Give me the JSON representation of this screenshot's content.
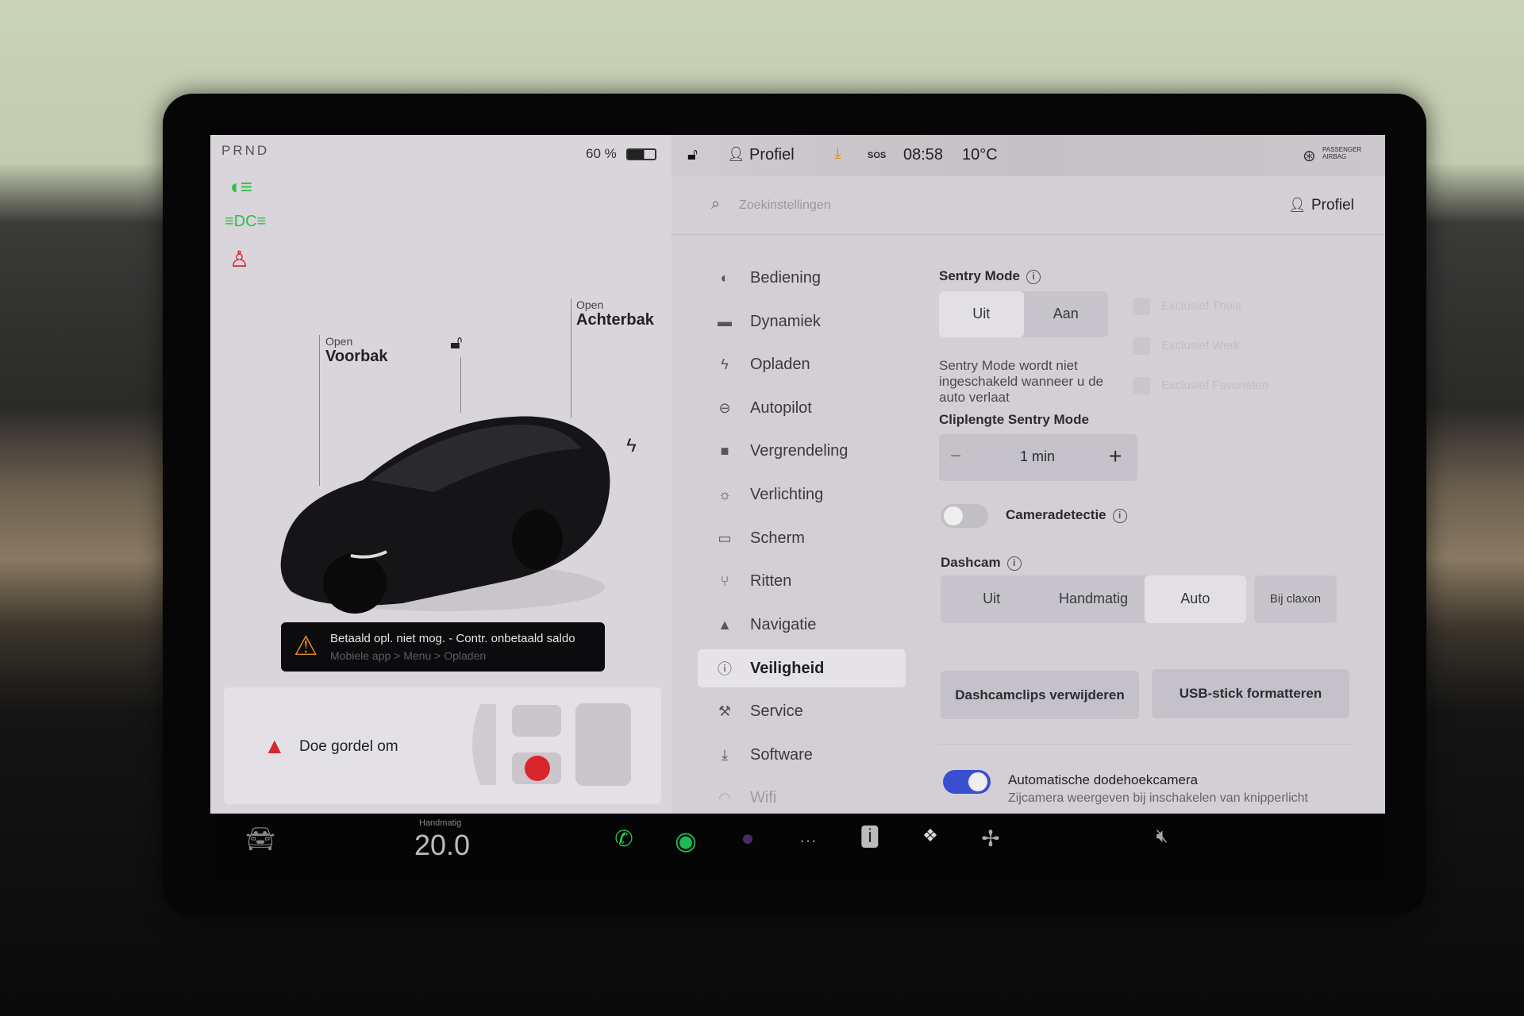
{
  "status": {
    "gear": "PRND",
    "battery": "60 %",
    "profile": "Profiel",
    "sos": "SOS",
    "time": "08:58",
    "temperature": "10°C",
    "airbag": "PASSENGER AIRBAG"
  },
  "left": {
    "frunk_state": "Open",
    "frunk": "Voorbak",
    "trunk_state": "Open",
    "trunk": "Achterbak",
    "alert_title": "Betaald opl. niet mog. - Contr. onbetaald saldo",
    "alert_sub": "Mobiele app > Menu > Opladen",
    "seatbelt": "Doe gordel om"
  },
  "search": {
    "placeholder": "Zoekinstellingen",
    "profile": "Profiel"
  },
  "menu": [
    {
      "label": "Bediening",
      "icon": "toggle-icon"
    },
    {
      "label": "Dynamiek",
      "icon": "car-icon"
    },
    {
      "label": "Opladen",
      "icon": "bolt-icon"
    },
    {
      "label": "Autopilot",
      "icon": "steering-wheel-icon"
    },
    {
      "label": "Vergrendeling",
      "icon": "lock-icon"
    },
    {
      "label": "Verlichting",
      "icon": "light-icon"
    },
    {
      "label": "Scherm",
      "icon": "display-icon"
    },
    {
      "label": "Ritten",
      "icon": "trips-icon"
    },
    {
      "label": "Navigatie",
      "icon": "navigation-icon"
    },
    {
      "label": "Veiligheid",
      "icon": "safety-icon",
      "selected": true
    },
    {
      "label": "Service",
      "icon": "wrench-icon"
    },
    {
      "label": "Software",
      "icon": "download-icon"
    },
    {
      "label": "Wifi",
      "icon": "wifi-icon"
    }
  ],
  "sentry": {
    "title": "Sentry Mode",
    "options": [
      "Uit",
      "Aan"
    ],
    "selected": "Uit",
    "description": "Sentry Mode wordt niet ingeschakeld wanneer u de auto verlaat",
    "exclusions": [
      "Exclusief Thuis",
      "Exclusief Werk",
      "Exclusief Favorieten"
    ]
  },
  "clip": {
    "title": "Cliplengte Sentry Mode",
    "value": "1 min",
    "minus": "−",
    "plus": "+"
  },
  "camera_detect": {
    "label": "Cameradetectie",
    "on": false
  },
  "dashcam": {
    "title": "Dashcam",
    "options": [
      "Uit",
      "Handmatig",
      "Auto"
    ],
    "selected": "Auto",
    "honk": "Bij claxon"
  },
  "buttons": {
    "delete": "Dashcamclips verwijderen",
    "format": "USB-stick formatteren"
  },
  "blindspot": {
    "label": "Automatische dodehoekcamera",
    "sub": "Zijcamera weergeven bij inschakelen van knipperlicht",
    "on": true
  },
  "bottom": {
    "climate_mode": "Handmatig",
    "temp": "20.0"
  },
  "colors": {
    "accent_blue": "#3a4fd0",
    "green": "#2fbf4a",
    "orange": "#e08a2a",
    "red": "#d8262c"
  }
}
